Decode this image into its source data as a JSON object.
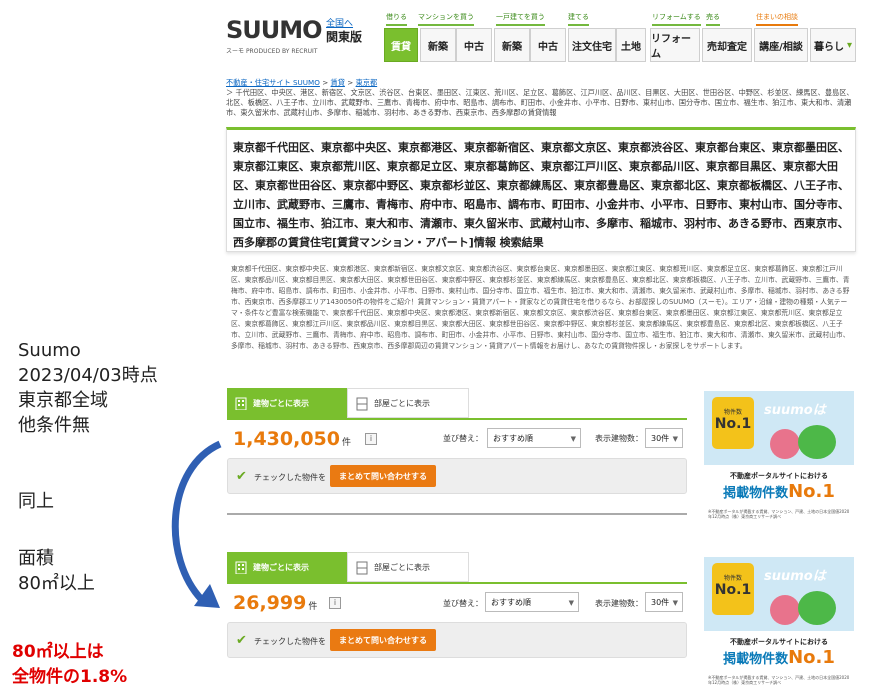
{
  "header": {
    "logo": "SUUMO",
    "logo_sub": "スーモ",
    "logo_tag": "PRODUCED BY RECRUIT",
    "region_link": "全国へ",
    "region_title": "関東版",
    "categories": [
      "借りる",
      "マンションを買う",
      "一戸建てを買う",
      "建てる",
      "リフォームする",
      "売る",
      "住まいの相談"
    ],
    "nav": [
      "賃貸",
      "新築",
      "中古",
      "新築",
      "中古",
      "注文住宅",
      "土地",
      "リフォーム",
      "売却査定",
      "講座/相談",
      "暮らし"
    ]
  },
  "breadcrumb": {
    "items": [
      "不動産・住宅サイト SUUMO",
      "賃貸",
      "東京都"
    ],
    "sep": ">",
    "areas": "＞ 千代田区、中央区、港区、新宿区、文京区、渋谷区、台東区、墨田区、江東区、荒川区、足立区、葛飾区、江戸川区、品川区、目黒区、大田区、世田谷区、中野区、杉並区、練馬区、豊島区、北区、板橋区、八王子市、立川市、武蔵野市、三鷹市、青梅市、府中市、昭島市、調布市、町田市、小金井市、小平市、日野市、東村山市、国分寺市、国立市、福生市、狛江市、東大和市、清瀬市、東久留米市、武蔵村山市、多摩市、稲城市、羽村市、あきる野市、西東京市、西多摩郡の賃貸情報"
  },
  "heading": "東京都千代田区、東京都中央区、東京都港区、東京都新宿区、東京都文京区、東京都渋谷区、東京都台東区、東京都墨田区、東京都江東区、東京都荒川区、東京都足立区、東京都葛飾区、東京都江戸川区、東京都品川区、東京都目黒区、東京都大田区、東京都世田谷区、東京都中野区、東京都杉並区、東京都練馬区、東京都豊島区、東京都北区、東京都板橋区、八王子市、立川市、武蔵野市、三鷹市、青梅市、府中市、昭島市、調布市、町田市、小金井市、小平市、日野市、東村山市、国分寺市、国立市、福生市、狛江市、東大和市、清瀬市、東久留米市、武蔵村山市、多摩市、稲城市、羽村市、あきる野市、西東京市、西多摩郡の賃貸住宅[賃貸マンション・アパート]情報 検索結果",
  "description": "東京都千代田区、東京都中央区、東京都港区、東京都新宿区、東京都文京区、東京都渋谷区、東京都台東区、東京都墨田区、東京都江東区、東京都荒川区、東京都足立区、東京都葛飾区、東京都江戸川区、東京都品川区、東京都目黒区、東京都大田区、東京都世田谷区、東京都中野区、東京都杉並区、東京都練馬区、東京都豊島区、東京都北区、東京都板橋区、八王子市、立川市、武蔵野市、三鷹市、青梅市、府中市、昭島市、調布市、町田市、小金井市、小平市、日野市、東村山市、国分寺市、国立市、福生市、狛江市、東大和市、清瀬市、東久留米市、武蔵村山市、多摩市、稲城市、羽村市、あきる野市、西東京市、西多摩郡エリア1430050件の物件をご紹介！賃貸マンション・賃貸アパート・貸家などの賃貸住宅を借りるなら、お部屋探しのSUUMO（スーモ）。エリア・沿線・建物の種類・人気テーマ・条件など豊富な検索機能で、東京都千代田区、東京都中央区、東京都港区、東京都新宿区、東京都文京区、東京都渋谷区、東京都台東区、東京都墨田区、東京都江東区、東京都荒川区、東京都足立区、東京都葛飾区、東京都江戸川区、東京都品川区、東京都目黒区、東京都大田区、東京都世田谷区、東京都中野区、東京都杉並区、東京都練馬区、東京都豊島区、東京都北区、東京都板橋区、八王子市、立川市、武蔵野市、三鷹市、青梅市、府中市、昭島市、調布市、町田市、小金井市、小平市、日野市、東村山市、国分寺市、国立市、福生市、狛江市、東大和市、清瀬市、東久留米市、武蔵村山市、多摩市、稲城市、羽村市、あきる野市、西東京市、西多摩郡周辺の賃貸マンション・賃貸アパート情報をお届けし、あなたの賃貸物件探し・お家探しをサポートします。",
  "annotations": {
    "note1": "Suumo\n2023/04/03時点\n東京都全域\n他条件無",
    "note2": "同上",
    "note3": "面積\n80㎡以上",
    "conclusion": "80㎡以上は\n全物件の1.8%"
  },
  "results": [
    {
      "tab_building": "建物ごとに表示",
      "tab_room": "部屋ごとに表示",
      "count": "1,430,050",
      "count_unit": "件",
      "sort_label": "並び替え：",
      "sort_value": "おすすめ順",
      "per_page_label": "表示建物数：",
      "per_page_value": "30件",
      "check_label": "チェックした物件を",
      "bulk_button": "まとめて問い合わせする"
    },
    {
      "tab_building": "建物ごとに表示",
      "tab_room": "部屋ごとに表示",
      "count": "26,999",
      "count_unit": "件",
      "sort_label": "並び替え：",
      "sort_value": "おすすめ順",
      "per_page_label": "表示建物数：",
      "per_page_value": "30件",
      "check_label": "チェックした物件を",
      "bulk_button": "まとめて問い合わせする"
    }
  ],
  "ad": {
    "medal_top": "物件数",
    "medal_main": "No.1",
    "logo": "suumoは",
    "line1": "不動産ポータルサイトにおける",
    "line2_a": "掲載物件数",
    "line2_b": "No.1",
    "fine": "※不動産ポータルが掲載する賃貸、マンション、戸建、土地の日本全国値2020年12月時点（株）東京商工リサーチ調べ"
  },
  "colors": {
    "brand_green": "#7abf2e",
    "count_orange": "#e87a0c",
    "button_orange": "#ea7a12",
    "arrow_blue": "#2f5fb3",
    "annotation_red": "#e00000"
  }
}
